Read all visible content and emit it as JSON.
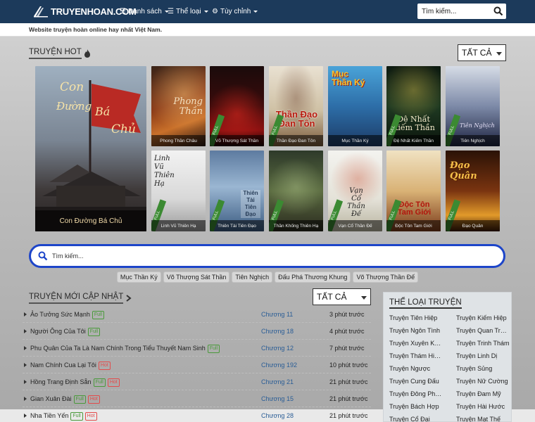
{
  "header": {
    "logo_text": "TRUYENHOAN.COM",
    "menu": [
      {
        "icon": "list-icon",
        "label": "Danh sách"
      },
      {
        "icon": "list-icon",
        "label": "Thể loại"
      },
      {
        "icon": "gear-icon",
        "label": "Tùy chỉnh"
      }
    ],
    "search_placeholder": "Tìm kiếm..."
  },
  "tagline": "Website truyện hoàn online hay nhất Việt Nam.",
  "hot": {
    "title": "TRUYỆN HOT",
    "title_icon": "fire-icon",
    "filter": "TẤT CẢ",
    "featured": {
      "title_art": "Con Đường Bá Chủ",
      "caption": "Con Đường Bá Chủ"
    },
    "row1": [
      {
        "caption": "Phong Thần Châu",
        "art": "Phong Thần",
        "full": false
      },
      {
        "caption": "Võ Thượng Sát Thần",
        "art": "",
        "full": true
      },
      {
        "caption": "Thần Đạo Đan Tôn",
        "art": "Thần Đạo Đan Tôn",
        "full": true
      },
      {
        "caption": "Mục Thần Ký",
        "art": "Mục Thần Ký",
        "full": false
      },
      {
        "caption": "Đệ Nhất Kiếm Thần",
        "art": "Đệ Nhất Kiếm Thần",
        "full": true
      },
      {
        "caption": "Tiên Nghịch",
        "art": "Tiên Nghịch",
        "full": true
      }
    ],
    "row2": [
      {
        "caption": "Linh Vũ Thiên Hạ",
        "art": "Linh Vũ Thiên Hạ",
        "full": true
      },
      {
        "caption": "Thiên Tài Tiên Đạo",
        "art": "Thiên Tài Tiên Đạo",
        "full": true
      },
      {
        "caption": "Thần Khống Thiên Hạ",
        "art": "",
        "full": true
      },
      {
        "caption": "Vạn Cổ Thần Đế",
        "art": "Vạn Cổ Thần Đế",
        "full": true
      },
      {
        "caption": "Độc Tôn Tam Giới",
        "art": "Độc Tôn Tam Giới",
        "full": true
      },
      {
        "caption": "Đạo Quân",
        "art": "Đạo Quân",
        "full": true
      }
    ]
  },
  "search": {
    "placeholder": "Tìm kiếm..."
  },
  "quick_tags": [
    "Mục Thần Ký",
    "Võ Thượng Sát Thần",
    "Tiên Nghịch",
    "Đấu Phá Thương Khung",
    "Võ Thượng Thần Đế"
  ],
  "new_updates": {
    "title": "TRUYỆN MỚI CẬP NHẬT",
    "filter": "TẤT CẢ",
    "rows": [
      {
        "title": "Ảo Tưởng Sức Mạnh",
        "full": true,
        "hot": false,
        "chapter": "Chương 11",
        "time": "3 phút trước"
      },
      {
        "title": "Người Ông Của Tôi",
        "full": true,
        "hot": false,
        "chapter": "Chương 18",
        "time": "4 phút trước"
      },
      {
        "title": "Phu Quân Của Ta Là Nam Chính Trong Tiểu Thuyết Nam Sinh",
        "full": true,
        "hot": false,
        "chapter": "Chương 12",
        "time": "7 phút trước"
      },
      {
        "title": "Nam Chính Cua Lại Tôi",
        "full": false,
        "hot": true,
        "chapter": "Chương 192",
        "time": "10 phút trước"
      },
      {
        "title": "Hồng Trang Định Sẵn",
        "full": true,
        "hot": true,
        "chapter": "Chương 21",
        "time": "21 phút trước"
      },
      {
        "title": "Gian Xuân Đài",
        "full": true,
        "hot": true,
        "chapter": "Chương 15",
        "time": "21 phút trước"
      },
      {
        "title": "Nha Tiền Yến",
        "full": true,
        "hot": true,
        "chapter": "Chương 28",
        "time": "21 phút trước"
      }
    ],
    "full_label": "Full",
    "hot_label": "Hot"
  },
  "genres": {
    "title": "THỂ LOẠI TRUYỆN",
    "items": [
      "Truyện Tiên Hiệp",
      "Truyện Kiếm Hiệp",
      "Truyện Ngôn Tình",
      "Truyện Quan Trường",
      "Truyện Xuyên Không",
      "Truyện Trinh Thám",
      "Truyện Thám Hiểm",
      "Truyện Linh Dị",
      "Truyện Ngược",
      "Truyện Sủng",
      "Truyện Cung Đấu",
      "Truyện Nữ Cường",
      "Truyện Đông Phương",
      "Truyện Đam Mỹ",
      "Truyện Bách Hợp",
      "Truyện Hài Hước",
      "Truyện Cổ Đại",
      "Truyện Mạt Thế"
    ]
  },
  "colors": {
    "nav": "#1c3a5b",
    "search_border": "#1d45c9",
    "full": "#4a9a3b",
    "hot": "#e34b4b",
    "chapter": "#2a5d96"
  }
}
